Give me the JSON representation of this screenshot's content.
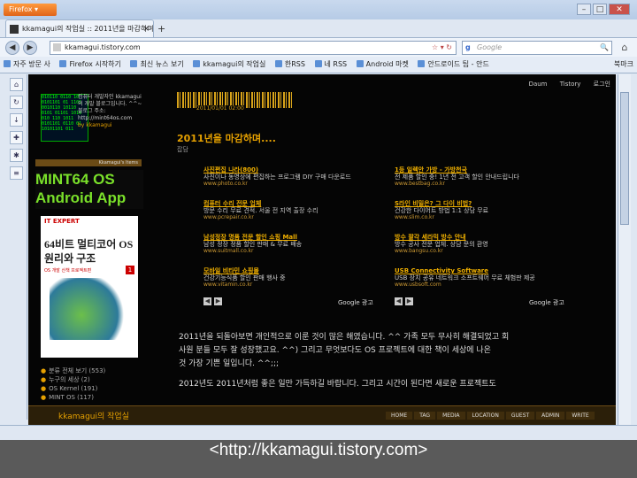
{
  "window": {
    "firefox_label": "Firefox ▾",
    "min": "–",
    "max": "□",
    "close": "✕"
  },
  "tab": {
    "title": "kkamagui의 작업실 :: 2011년을 마감하며...",
    "close": "×",
    "new_tab": "+"
  },
  "nav": {
    "url": "kkamagui.tistory.com",
    "url_icons": "☆ ▾ ↻",
    "search_engine": "g",
    "search_placeholder": "Google",
    "search_icon": "🔍",
    "home_icon": "⌂"
  },
  "bookmarks": {
    "items": [
      "자주 방문 사",
      "Firefox 시작하기",
      "최신 뉴스 보기",
      "kkamagui의 작업실",
      "한RSS",
      "네 RSS",
      "Android 마켓",
      "안드로이드 팁 - 안드"
    ],
    "right": "북마크"
  },
  "page": {
    "left": {
      "matrix": "010110 0110 10 0101101 01 1101 0010110 10110 0101 01101 1010 010 110 1011 0101101 0110 01 10101101 011",
      "profile_text": "컴퓨터 개발자인 kkamagui의 개발 블로그입니다. ^^~ 블로그 주소: http://mint64os.com",
      "profile_name": "by kkamagui",
      "tag_bar": "Kkamagui's Items",
      "mint_line1": "MINT64 OS",
      "mint_line2": "Android App",
      "book_publisher": "IT EXPERT",
      "book_title": "64비트 멀티코어 OS 원리와 구조",
      "book_subtitle": "OS 개발 산책 프로젝트편",
      "book_volume": "1",
      "categories": [
        "분류 전체 보기 (553)",
        "누구의 세상 (2)",
        "OS Kernel (191)",
        "MINT OS (117)"
      ]
    },
    "menu": [
      "Daum",
      "Tistory",
      "로그인"
    ],
    "post": {
      "date": "2011/01/01 02:00",
      "title": "2011년을 마감하며....",
      "category": "잡담",
      "ads": [
        {
          "h": "사진편집 나라(800)",
          "d": "사진이나 동영상에 편집하는 프로그램 DIY 구매 다운로드",
          "u": "www.photo.co.kr"
        },
        {
          "h": "1등 일렉안 가방 - 가방천국",
          "d": "전 제품 할인 중! 1년 전 고객 할인 안내드립니다",
          "u": "www.bestbag.co.kr"
        },
        {
          "h": "컴퓨터 수리 전문 업체",
          "d": "방문 수리 무료 견적. 서울 전 지역 출장 수리",
          "u": "www.pcrepair.co.kr"
        },
        {
          "h": "S라인 비밀은? 그 다이 비법?",
          "d": "건강한 다이어트 방법 1:1 상담 무료",
          "u": "www.slim.co.kr"
        },
        {
          "h": "남성정장 명품 전문 할인 쇼핑 Mall",
          "d": "남성 정장 정품 할인 판매 & 무료 배송",
          "u": "www.suitmall.co.kr"
        },
        {
          "h": "방수 팔각 세라믹 방수 안내",
          "d": "방수 공사 전문 업체. 상담 문의 환영",
          "u": "www.bangsu.co.kr"
        },
        {
          "h": "모바일 비타민 쇼핑몰",
          "d": "건강기능식품 할인 판매 행사 중",
          "u": "www.vitamin.co.kr"
        },
        {
          "h": "USB Connectivity Software",
          "d": "USB 장치 공유 네트워크 소프트웨어 무료 체험판 제공",
          "u": "www.usbsoft.com"
        }
      ],
      "google_label": "Google 광고",
      "prev": "◀",
      "next": "▶",
      "body_lines": [
        "2011년을 되돌아보면 개인적으로 이룬 것이 많은 해였습니다. ^^ 가족 모두 무사히 해결되었고 회",
        "사원 분들 모두 잘 성장했고요. ^^) 그리고 무엇보다도 OS 프로젝트에 대한 책이 세상에 나온",
        "것 가장 기쁜 일입니다. ^^;;;",
        "2012년도 2011년처럼 좋은 일만 가득하길 바랍니다. 그리고 시간이 된다면 새로운 프로젝트도"
      ]
    },
    "bottom": {
      "blog_name": "kkamagui의 작업실",
      "nav": [
        "HOME",
        "TAG",
        "MEDIA",
        "LOCATION",
        "GUEST",
        "ADMIN",
        "WRITE"
      ]
    }
  },
  "caption": "<http://kkamagui.tistory.com>"
}
